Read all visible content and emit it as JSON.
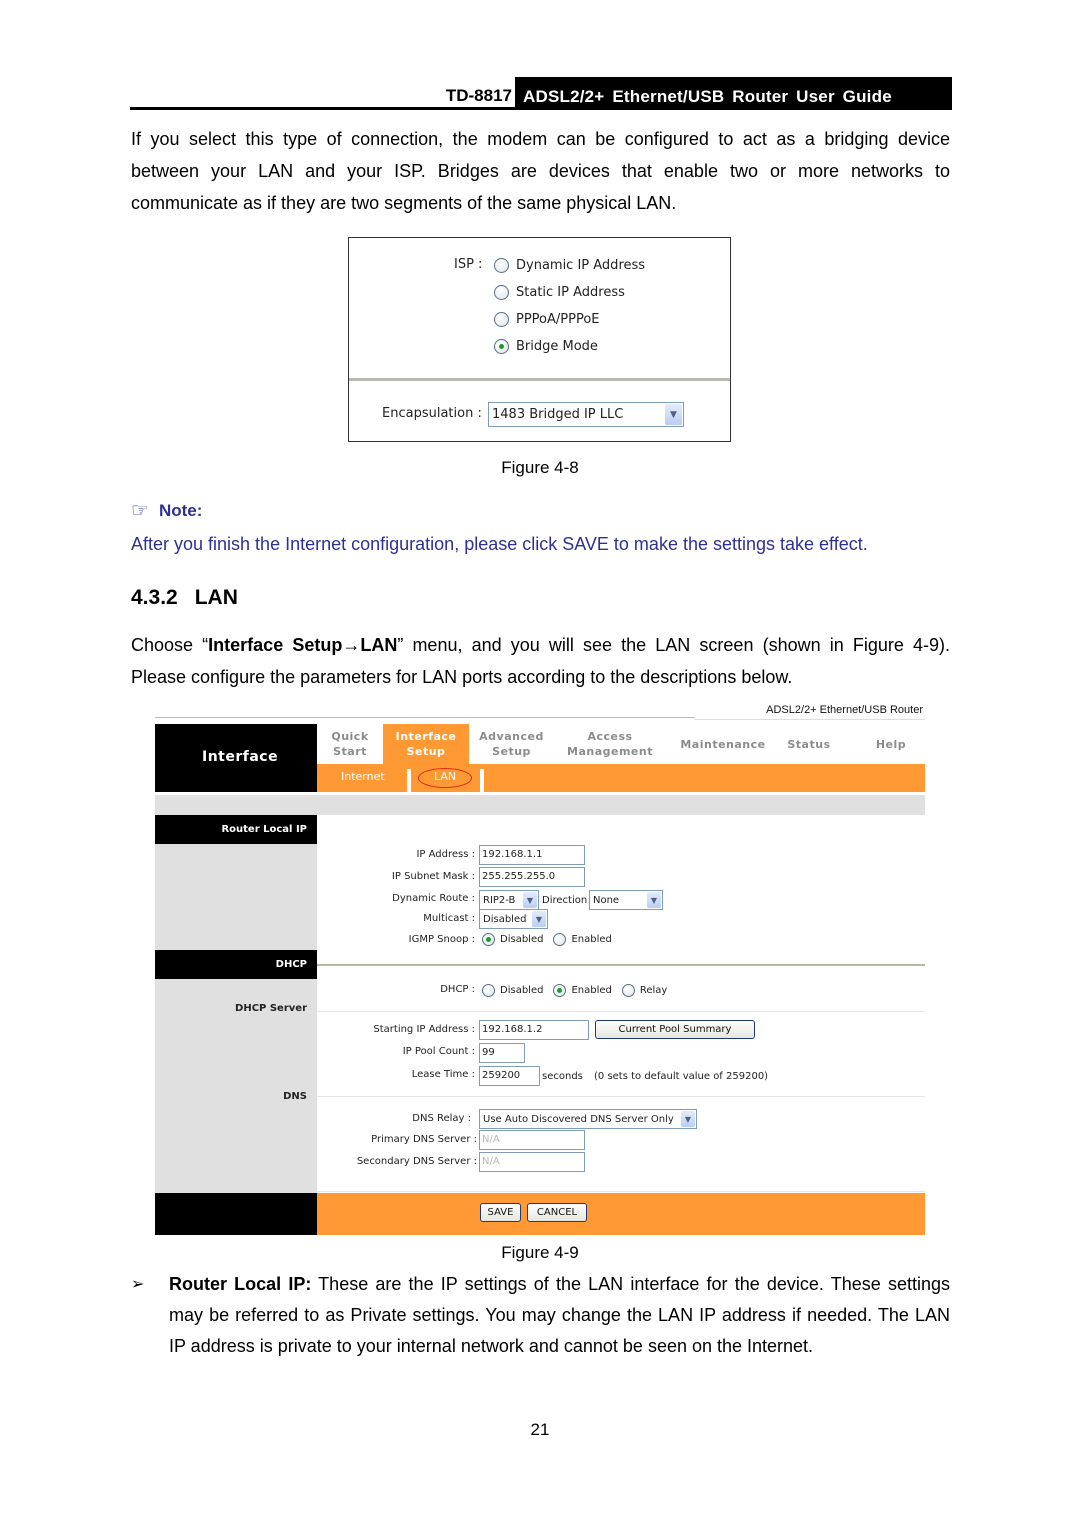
{
  "header": {
    "model": "TD-8817",
    "title": "ADSL2/2+ Ethernet/USB Router User Guide"
  },
  "intro_paragraph": {
    "line1": "If you select this type of connection, the modem can be configured to act as a bridging device",
    "line2": "between your LAN and your ISP. Bridges are devices that enable two or more networks to",
    "line3": "communicate as if they are two segments of the same physical LAN."
  },
  "figure_4_8": {
    "isp_label": "ISP :",
    "options": [
      {
        "label": "Dynamic IP Address",
        "checked": false
      },
      {
        "label": "Static IP Address",
        "checked": false
      },
      {
        "label": "PPPoA/PPPoE",
        "checked": false
      },
      {
        "label": "Bridge Mode",
        "checked": true
      }
    ],
    "encapsulation_label": "Encapsulation :",
    "encapsulation_value": "1483 Bridged IP LLC",
    "caption": "Figure 4-8"
  },
  "note": {
    "icon": "pointing-hand-icon",
    "title": "Note:",
    "text": "After you finish the Internet configuration, please click SAVE to make the settings take effect."
  },
  "section": {
    "number": "4.3.2",
    "title": "LAN",
    "para_prefix": "Choose “",
    "para_bold": "Interface Setup→LAN",
    "para_suffix": "” menu, and you will see the LAN screen (shown in Figure 4-9).",
    "para_line2": "Please configure the parameters for LAN ports according to the descriptions below."
  },
  "router_ui": {
    "brand": "ADSL2/2+ Ethernet/USB Router",
    "left_title": "Interface",
    "tabs": [
      {
        "line1": "Quick",
        "line2": "Start",
        "active": false
      },
      {
        "line1": "Interface",
        "line2": "Setup",
        "active": true
      },
      {
        "line1": "Advanced",
        "line2": "Setup",
        "active": false
      },
      {
        "line1": "Access",
        "line2": "Management",
        "active": false
      },
      {
        "line1": "Maintenance",
        "line2": "",
        "active": false
      },
      {
        "line1": "Status",
        "line2": "",
        "active": false
      },
      {
        "line1": "Help",
        "line2": "",
        "active": false
      }
    ],
    "subtabs": [
      {
        "label": "Internet",
        "active": false
      },
      {
        "label": "LAN",
        "active": true
      }
    ],
    "sections": {
      "router_local_ip": "Router Local IP",
      "dhcp": "DHCP",
      "dhcp_server": "DHCP Server",
      "dns": "DNS"
    },
    "fields": {
      "ip_address": {
        "label": "IP Address :",
        "value": "192.168.1.1"
      },
      "subnet_mask": {
        "label": "IP Subnet Mask :",
        "value": "255.255.255.0"
      },
      "dynamic_route": {
        "label": "Dynamic Route :",
        "value": "RIP2-B"
      },
      "direction": {
        "label": "Direction",
        "value": "None"
      },
      "multicast": {
        "label": "Multicast :",
        "value": "Disabled"
      },
      "igmp_snoop": {
        "label": "IGMP Snoop :",
        "options": [
          {
            "label": "Disabled",
            "checked": true
          },
          {
            "label": "Enabled",
            "checked": false
          }
        ]
      },
      "dhcp": {
        "label": "DHCP :",
        "options": [
          {
            "label": "Disabled",
            "checked": false
          },
          {
            "label": "Enabled",
            "checked": true
          },
          {
            "label": "Relay",
            "checked": false
          }
        ]
      },
      "starting_ip": {
        "label": "Starting IP Address :",
        "value": "192.168.1.2"
      },
      "pool_summary_button": "Current Pool Summary",
      "pool_count": {
        "label": "IP Pool Count :",
        "value": "99"
      },
      "lease_time": {
        "label": "Lease Time :",
        "value": "259200",
        "unit": "seconds",
        "hint": "(0 sets to default value of 259200)"
      },
      "dns_relay": {
        "label": "DNS Relay :",
        "value": "Use Auto Discovered DNS Server Only"
      },
      "primary_dns": {
        "label": "Primary DNS Server  :",
        "value": "N/A"
      },
      "secondary_dns": {
        "label": "Secondary DNS Server :",
        "value": "N/A"
      }
    },
    "buttons": {
      "save": "SAVE",
      "cancel": "CANCEL"
    },
    "colors": {
      "accent_orange": "#ff9933",
      "black": "#000000",
      "gray_panel": "#e0e0e0"
    }
  },
  "figure_4_9_caption": "Figure 4-9",
  "bullet": {
    "mark": "➢",
    "bold": "Router Local IP:",
    "text": " These are the IP settings of the LAN interface for the device. These settings may be referred to as Private settings. You may change the LAN IP address if needed. The LAN IP address is private to your internal network and cannot be seen on the Internet."
  },
  "page_number": "21"
}
